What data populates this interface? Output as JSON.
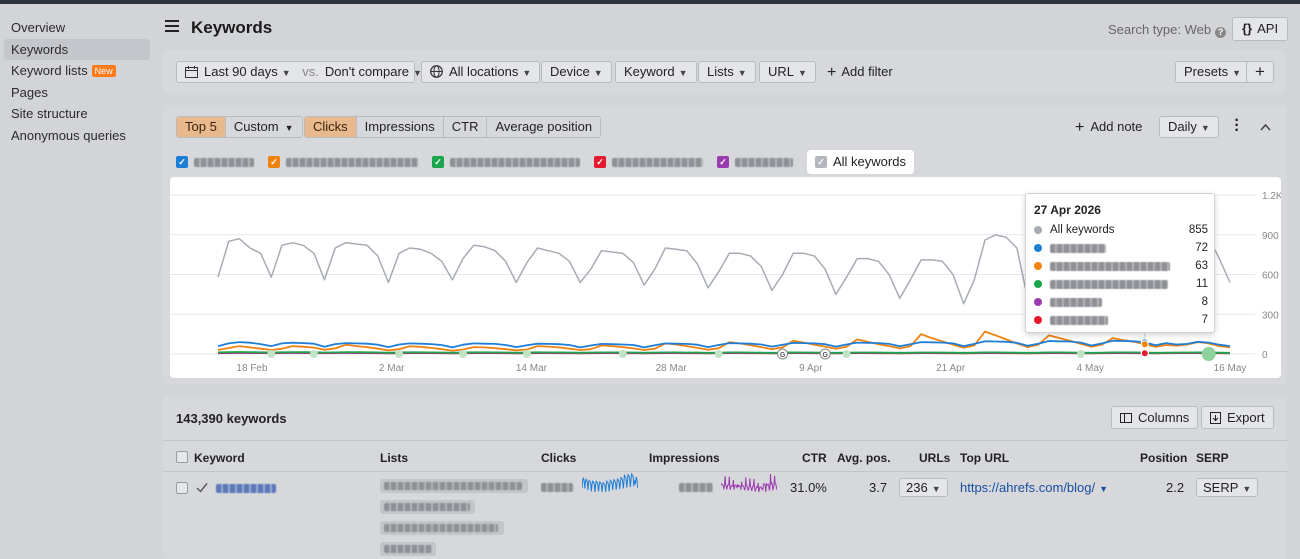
{
  "sidebar": {
    "items": [
      {
        "label": "Overview",
        "active": false
      },
      {
        "label": "Keywords",
        "active": true
      },
      {
        "label": "Keyword lists",
        "badge": "New",
        "active": false
      },
      {
        "label": "Pages",
        "active": false
      },
      {
        "label": "Site structure",
        "active": false
      },
      {
        "label": "Anonymous queries",
        "active": false
      }
    ]
  },
  "header": {
    "title": "Keywords",
    "search_type": "Search type: Web",
    "help_glyph": "?",
    "api_label": "API",
    "api_glyph": "{}"
  },
  "filters": {
    "date_range": "Last 90 days",
    "vs_label": "vs.",
    "compare": "Don't compare",
    "location": "All locations",
    "device": "Device",
    "keyword": "Keyword",
    "lists": "Lists",
    "url": "URL",
    "add_filter": "Add filter",
    "presets": "Presets",
    "plus_glyph": "+"
  },
  "chart_controls": {
    "top_tabs": [
      "Top 5",
      "Custom"
    ],
    "metric_tabs": [
      "Clicks",
      "Impressions",
      "CTR",
      "Average position"
    ],
    "active_metric": "Clicks",
    "add_note": "Add note",
    "granularity": "Daily",
    "all_keywords_label": "All keywords"
  },
  "colors": {
    "all_keywords": "#a7abb3",
    "series_1": "#1e7ed6",
    "series_2": "#f0820f",
    "series_3": "#1aa64a",
    "series_4": "#9b3bb0",
    "series_5": "#e6192e",
    "accent_tab": "#e7b98c",
    "link": "#1a4fa3"
  },
  "chart_data": {
    "type": "line",
    "x": [
      "18 Feb",
      "2 Mar",
      "14 Mar",
      "28 Mar",
      "9 Apr",
      "21 Apr",
      "4 May",
      "16 May"
    ],
    "ylim": [
      0,
      1200
    ],
    "yticks": [
      "1.2K",
      "900",
      "600",
      "300",
      "0"
    ],
    "grid": true,
    "series": [
      {
        "name": "All keywords",
        "values": [
          580,
          850,
          870,
          800,
          760,
          580,
          820,
          840,
          820,
          760,
          560,
          800,
          840,
          830,
          820,
          740,
          540,
          760,
          800,
          790,
          760,
          700,
          560,
          720,
          820,
          810,
          780,
          700,
          540,
          690,
          800,
          780,
          760,
          700,
          540,
          640,
          780,
          770,
          760,
          690,
          520,
          640,
          800,
          790,
          780,
          680,
          500,
          620,
          760,
          760,
          740,
          660,
          480,
          600,
          760,
          760,
          740,
          640,
          450,
          580,
          720,
          720,
          700,
          600,
          420,
          560,
          710,
          710,
          700,
          600,
          380,
          560,
          860,
          900,
          880,
          800,
          420,
          580,
          840,
          830,
          870,
          820,
          510,
          630,
          920,
          900,
          960,
          860,
          560,
          640,
          880,
          855,
          880,
          880,
          720,
          540
        ]
      },
      {
        "name": "",
        "values": [
          60,
          80,
          90,
          85,
          75,
          60,
          80,
          85,
          82,
          78,
          55,
          75,
          82,
          80,
          78,
          70,
          52,
          72,
          80,
          78,
          75,
          68,
          50,
          70,
          80,
          78,
          76,
          68,
          52,
          66,
          78,
          76,
          74,
          68,
          50,
          64,
          76,
          74,
          72,
          68,
          50,
          66,
          80,
          78,
          76,
          70,
          52,
          68,
          82,
          80,
          78,
          72,
          56,
          70,
          84,
          82,
          80,
          74,
          56,
          72,
          86,
          84,
          82,
          76,
          58,
          74,
          90,
          88,
          86,
          80,
          60,
          76,
          96,
          94,
          92,
          84,
          62,
          78,
          98,
          96,
          94,
          86,
          64,
          80,
          100,
          98,
          96,
          88,
          66,
          82,
          72,
          76,
          92,
          86,
          70,
          60
        ]
      },
      {
        "name": "",
        "values": [
          30,
          45,
          60,
          50,
          40,
          30,
          40,
          60,
          55,
          48,
          32,
          42,
          70,
          60,
          52,
          40,
          28,
          36,
          58,
          54,
          46,
          36,
          26,
          34,
          52,
          50,
          44,
          36,
          28,
          34,
          60,
          56,
          50,
          40,
          30,
          36,
          64,
          60,
          52,
          42,
          30,
          40,
          80,
          72,
          60,
          46,
          32,
          44,
          90,
          80,
          66,
          52,
          36,
          50,
          100,
          86,
          70,
          56,
          40,
          54,
          110,
          92,
          74,
          60,
          42,
          58,
          150,
          120,
          96,
          70,
          48,
          64,
          170,
          140,
          110,
          80,
          52,
          70,
          140,
          120,
          100,
          76,
          54,
          72,
          120,
          104,
          92,
          74,
          54,
          68,
          63,
          72,
          90,
          80,
          60,
          50
        ]
      },
      {
        "name": "",
        "values": [
          12,
          14,
          15,
          14,
          13,
          11,
          13,
          14,
          14,
          13,
          11,
          12,
          14,
          14,
          13,
          12,
          10,
          12,
          13,
          13,
          12,
          11,
          10,
          11,
          13,
          13,
          12,
          11,
          10,
          11,
          13,
          12,
          12,
          11,
          10,
          11,
          12,
          12,
          12,
          11,
          10,
          11,
          12,
          12,
          11,
          11,
          9,
          10,
          12,
          12,
          11,
          10,
          9,
          10,
          12,
          11,
          11,
          10,
          9,
          10,
          11,
          11,
          11,
          10,
          9,
          10,
          11,
          11,
          11,
          10,
          9,
          10,
          12,
          12,
          11,
          10,
          9,
          10,
          12,
          12,
          11,
          10,
          9,
          10,
          12,
          12,
          12,
          11,
          9,
          10,
          11,
          11,
          12,
          11,
          10,
          9
        ]
      },
      {
        "name": "",
        "values": [
          8,
          9,
          10,
          9,
          9,
          8,
          9,
          10,
          9,
          9,
          8,
          9,
          10,
          9,
          9,
          8,
          7,
          8,
          9,
          9,
          9,
          8,
          7,
          8,
          9,
          9,
          9,
          8,
          7,
          8,
          9,
          9,
          8,
          8,
          7,
          8,
          9,
          9,
          8,
          8,
          7,
          8,
          9,
          9,
          8,
          8,
          7,
          8,
          9,
          9,
          8,
          8,
          7,
          8,
          9,
          9,
          8,
          8,
          7,
          8,
          9,
          9,
          8,
          8,
          7,
          8,
          9,
          9,
          8,
          8,
          7,
          8,
          9,
          9,
          8,
          8,
          7,
          8,
          9,
          9,
          8,
          8,
          7,
          8,
          9,
          9,
          8,
          8,
          7,
          8,
          8,
          8,
          9,
          8,
          8,
          7
        ]
      },
      {
        "name": "",
        "values": [
          6,
          7,
          8,
          7,
          7,
          6,
          7,
          8,
          7,
          7,
          6,
          7,
          8,
          7,
          7,
          6,
          5,
          6,
          7,
          7,
          7,
          6,
          5,
          6,
          7,
          7,
          7,
          6,
          5,
          6,
          7,
          7,
          6,
          6,
          5,
          6,
          7,
          7,
          6,
          6,
          5,
          6,
          7,
          7,
          6,
          6,
          5,
          6,
          7,
          7,
          6,
          6,
          5,
          6,
          7,
          7,
          6,
          6,
          5,
          6,
          7,
          7,
          6,
          6,
          5,
          6,
          7,
          7,
          6,
          6,
          5,
          6,
          7,
          7,
          6,
          6,
          5,
          6,
          7,
          7,
          6,
          6,
          5,
          6,
          7,
          7,
          6,
          6,
          5,
          6,
          7,
          7,
          7,
          6,
          6,
          5
        ]
      }
    ],
    "highlight_index": 87,
    "annotation_indices": [
      5,
      9,
      17,
      23,
      29,
      38,
      47,
      53,
      59,
      81
    ],
    "google_update_indices": [
      53,
      57
    ],
    "tooltip": {
      "date": "27 Apr 2026",
      "rows": [
        {
          "name": "All keywords",
          "value": "855"
        },
        {
          "name": "",
          "value": "72"
        },
        {
          "name": "",
          "value": "63"
        },
        {
          "name": "",
          "value": "11"
        },
        {
          "name": "",
          "value": "8"
        },
        {
          "name": "",
          "value": "7"
        }
      ]
    }
  },
  "table": {
    "count_label": "143,390 keywords",
    "columns_btn": "Columns",
    "export_btn": "Export",
    "headers": [
      "Keyword",
      "Lists",
      "Clicks",
      "Impressions",
      "CTR",
      "Avg. pos.",
      "URLs",
      "Top URL",
      "Position",
      "SERP"
    ],
    "rows": [
      {
        "ctr": "31.0%",
        "avg_pos": "3.7",
        "urls": "236",
        "top_url": "https://ahrefs.com/blog/",
        "position": "2.2",
        "serp": "SERP"
      }
    ]
  }
}
